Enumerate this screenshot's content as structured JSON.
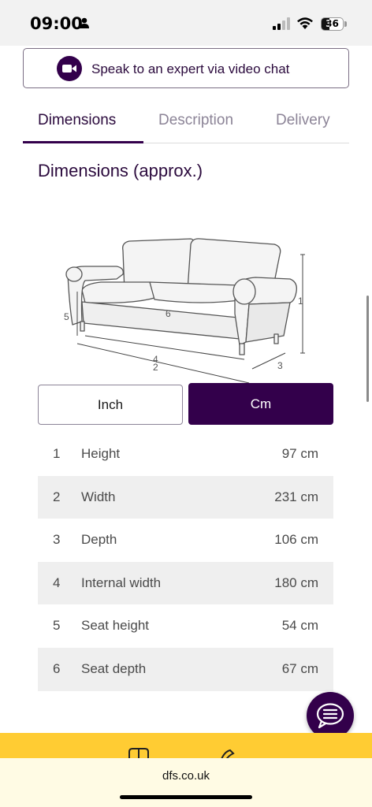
{
  "status_bar": {
    "time": "09:00",
    "battery": "36",
    "battery_level": 0.36
  },
  "expert_button": {
    "label": "Speak to an expert via video chat",
    "icon": "video-camera-icon"
  },
  "tabs": [
    {
      "label": "Dimensions",
      "active": true
    },
    {
      "label": "Description",
      "active": false
    },
    {
      "label": "Delivery",
      "active": false
    }
  ],
  "section_title": "Dimensions (approx.)",
  "diagram_labels": {
    "height": "1",
    "width": "2",
    "depth": "3",
    "internal_width": "4",
    "seat_height": "5",
    "seat_depth": "6"
  },
  "units": {
    "inch": "Inch",
    "cm": "Cm",
    "selected": "cm"
  },
  "dimensions": [
    {
      "num": "1",
      "label": "Height",
      "value": "97 cm"
    },
    {
      "num": "2",
      "label": "Width",
      "value": "231 cm"
    },
    {
      "num": "3",
      "label": "Depth",
      "value": "106 cm"
    },
    {
      "num": "4",
      "label": "Internal width",
      "value": "180 cm"
    },
    {
      "num": "5",
      "label": "Seat height",
      "value": "54 cm"
    },
    {
      "num": "6",
      "label": "Seat depth",
      "value": "67 cm"
    }
  ],
  "browser": {
    "url": "dfs.co.uk"
  },
  "colors": {
    "brand_purple": "#33004b",
    "yellow": "#ffcc33",
    "row_alt": "#efefef"
  }
}
